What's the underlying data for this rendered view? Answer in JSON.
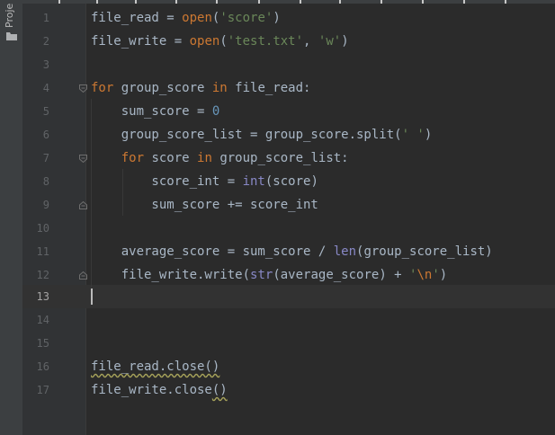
{
  "sidebar": {
    "tab_label": "Proje",
    "folder_icon": "folder-icon"
  },
  "editor": {
    "current_line": "13",
    "lines": [
      {
        "number": "1",
        "seg": [
          "file_read",
          " = ",
          "open",
          "(",
          "'score'",
          ")"
        ]
      },
      {
        "number": "2",
        "seg": [
          "file_write",
          " = ",
          "open",
          "(",
          "'test.txt'",
          ", ",
          "'w'",
          ")"
        ]
      },
      {
        "number": "3"
      },
      {
        "number": "4",
        "seg": [
          "for",
          " group_score ",
          "in",
          " file_read:"
        ]
      },
      {
        "number": "5",
        "seg": [
          "    sum_score = ",
          "0"
        ]
      },
      {
        "number": "6",
        "seg": [
          "    group_score_list = group_score.split(",
          "' '",
          ")"
        ]
      },
      {
        "number": "7",
        "seg": [
          "    ",
          "for",
          " score ",
          "in",
          " group_score_list:"
        ]
      },
      {
        "number": "8",
        "seg": [
          "        score_int = ",
          "int",
          "(score)"
        ]
      },
      {
        "number": "9",
        "seg": [
          "        sum_score += score_int"
        ]
      },
      {
        "number": "10"
      },
      {
        "number": "11",
        "seg": [
          "    average_score = sum_score / ",
          "len",
          "(group_score_list)"
        ]
      },
      {
        "number": "12",
        "seg": [
          "    file_write.write(",
          "str",
          "(average_score) + ",
          "'",
          "\\n",
          "'",
          ")"
        ]
      },
      {
        "number": "13"
      },
      {
        "number": "14"
      },
      {
        "number": "15"
      },
      {
        "number": "16",
        "seg": [
          "file_read.close()"
        ]
      },
      {
        "number": "17",
        "seg": [
          "file_write.close",
          "()"
        ]
      }
    ]
  },
  "colors": {
    "background": "#2b2b2b",
    "keyword": "#cc7832",
    "string": "#6a8759",
    "number": "#6897bb",
    "builtin": "#8888c6",
    "identifier": "#a9b7c6"
  }
}
